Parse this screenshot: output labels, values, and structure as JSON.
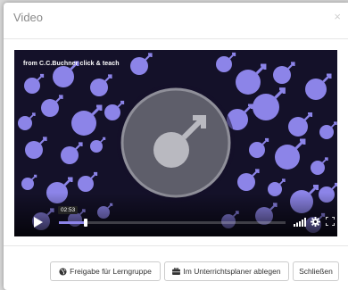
{
  "modal": {
    "title": "Video",
    "close_glyph": "×"
  },
  "video": {
    "caption": "from C.C.Buchner click & teach",
    "current_time": "02:53",
    "progress_fraction": 0.12,
    "subject_icon": "male-symbol-icon",
    "colors": {
      "background": "#141129",
      "symbol": "#8c84e8",
      "center_circle": "#5e5e6a"
    }
  },
  "footer": {
    "share_label": "Freigabe für Lerngruppe",
    "planner_label": "Im Unterrichtsplaner ablegen",
    "close_label": "Schließen"
  }
}
